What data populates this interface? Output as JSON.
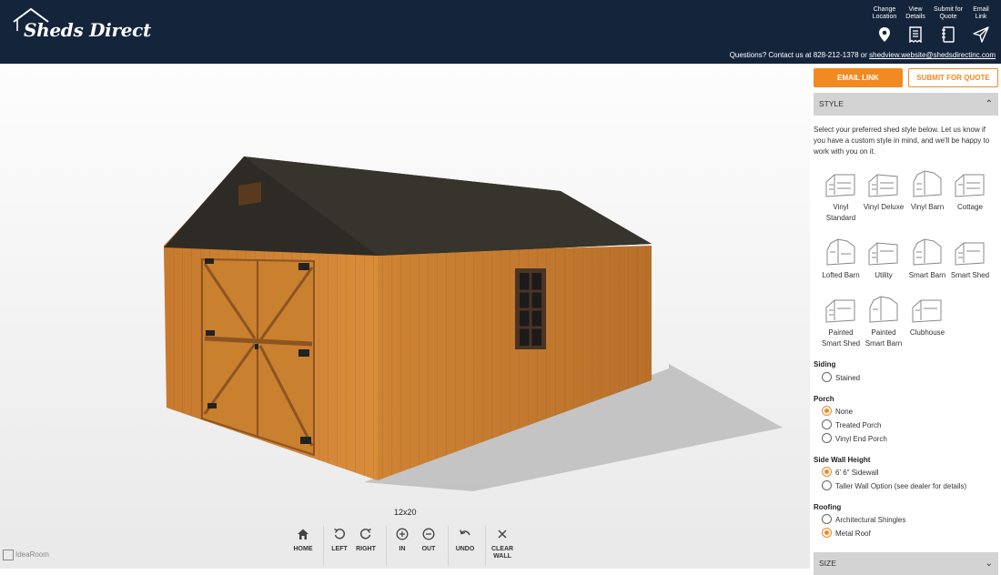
{
  "header": {
    "logo_text": "Sheds Direct",
    "buttons": [
      {
        "label": "Change Location",
        "icon": "map-pin-icon"
      },
      {
        "label": "View Details",
        "icon": "receipt-icon"
      },
      {
        "label": "Submit for Quote",
        "icon": "notebook-icon"
      },
      {
        "label": "Email Link",
        "icon": "send-icon"
      }
    ],
    "contact_text": "Questions? Contact us at 828-212-1378 or",
    "contact_email": "shedview.website@shedsdirectinc.com"
  },
  "viewer": {
    "dimension_label": "12x20",
    "toolbar": [
      {
        "label": "HOME",
        "icon": "home-icon"
      },
      {
        "label": "LEFT",
        "icon": "rotate-left-icon"
      },
      {
        "label": "RIGHT",
        "icon": "rotate-right-icon"
      },
      {
        "label": "IN",
        "icon": "zoom-in-icon"
      },
      {
        "label": "OUT",
        "icon": "zoom-out-icon"
      },
      {
        "label": "UNDO",
        "icon": "undo-icon"
      },
      {
        "label": "CLEAR WALL",
        "icon": "close-icon"
      }
    ],
    "brand": "IdeaRoom"
  },
  "panel": {
    "email_button": "EMAIL LINK",
    "quote_button": "SUBMIT FOR QUOTE",
    "style_section": "STYLE",
    "style_description": "Select your preferred shed style below. Let us know if you have a custom style in mind, and we'll be happy to work with you on it.",
    "styles": [
      "Vinyl Standard",
      "Vinyl Deluxe",
      "Vinyl Barn",
      "Cottage",
      "Lofted Barn",
      "Utility",
      "Smart Barn",
      "Smart Shed",
      "Painted Smart Shed",
      "Painted Smart Barn",
      "Clubhouse"
    ],
    "groups": [
      {
        "label": "Siding",
        "options": [
          {
            "label": "Stained",
            "selected": false
          }
        ]
      },
      {
        "label": "Porch",
        "options": [
          {
            "label": "None",
            "selected": true
          },
          {
            "label": "Treated Porch",
            "selected": false
          },
          {
            "label": "Vinyl End Porch",
            "selected": false
          }
        ]
      },
      {
        "label": "Side Wall Height",
        "options": [
          {
            "label": "6' 6\" Sidewall",
            "selected": true
          },
          {
            "label": "Taller Wall Option (see dealer for details)",
            "selected": false
          }
        ]
      },
      {
        "label": "Roofing",
        "options": [
          {
            "label": "Architectural Shingles",
            "selected": false
          },
          {
            "label": "Metal Roof",
            "selected": true
          }
        ]
      }
    ],
    "size_section": "SIZE"
  },
  "colors": {
    "header_bg": "#14243b",
    "accent": "#f28a22",
    "section_bg": "#d3d3d3"
  }
}
